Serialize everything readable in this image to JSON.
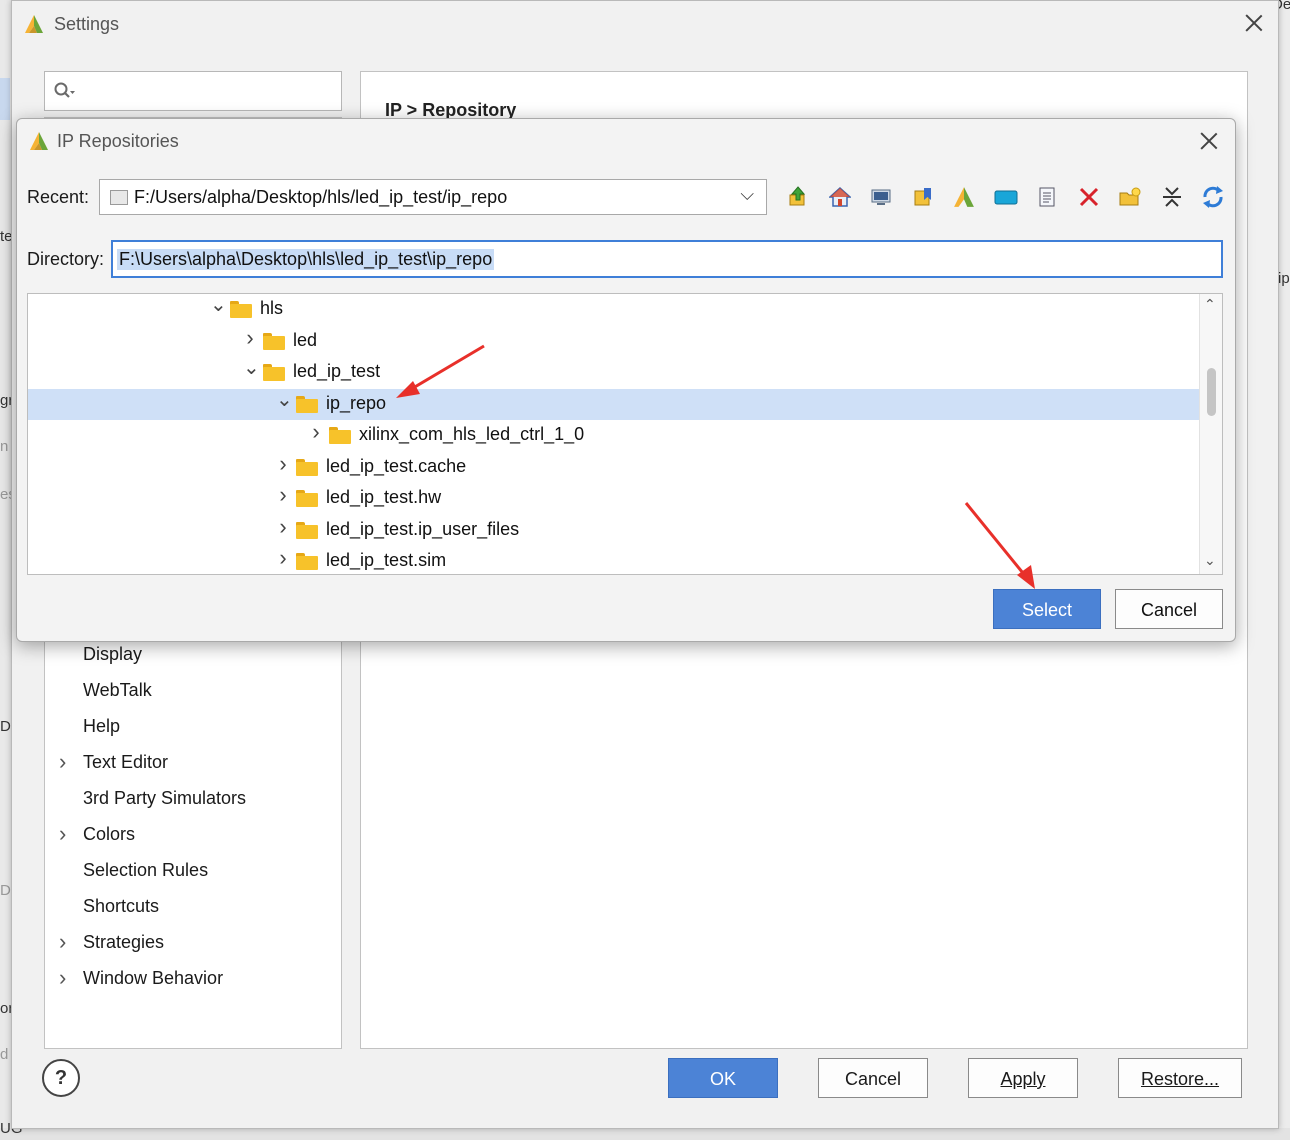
{
  "colors": {
    "accent": "#4c83d6",
    "selection": "#cfe0f7",
    "folder": "#f7c22a",
    "annotation_arrow": "#e8302a"
  },
  "background_fragments": {
    "te": "te",
    "gr": "gr",
    "n": "n",
    "es": "es",
    "De": "De",
    "D": "D",
    "or": "or",
    "d": "d",
    "UG": "UG",
    "ip": "ip",
    "top_right": "De"
  },
  "settings": {
    "title": "Settings",
    "search": {
      "placeholder": "",
      "icon": "search-icon"
    },
    "right_heading": "IP > Repository",
    "nav_items": [
      {
        "label": "Display",
        "expandable": false
      },
      {
        "label": "WebTalk",
        "expandable": false
      },
      {
        "label": "Help",
        "expandable": false
      },
      {
        "label": "Text Editor",
        "expandable": true
      },
      {
        "label": "3rd Party Simulators",
        "expandable": false
      },
      {
        "label": "Colors",
        "expandable": true
      },
      {
        "label": "Selection Rules",
        "expandable": false
      },
      {
        "label": "Shortcuts",
        "expandable": false
      },
      {
        "label": "Strategies",
        "expandable": true
      },
      {
        "label": "Window Behavior",
        "expandable": true
      }
    ],
    "help_label": "?",
    "buttons": {
      "ok": "OK",
      "cancel": "Cancel",
      "apply": "Apply",
      "restore": "Restore..."
    }
  },
  "ip_dialog": {
    "title": "IP Repositories",
    "recent_label": "Recent:",
    "recent_value": "F:/Users/alpha/Desktop/hls/led_ip_test/ip_repo",
    "directory_label": "Directory:",
    "directory_value": "F:\\Users\\alpha\\Desktop\\hls\\led_ip_test\\ip_repo",
    "toolbar_icons": [
      "up-folder-icon",
      "home-icon",
      "desktop-icon",
      "bookmark-icon",
      "vivado-project-icon",
      "panel-icon",
      "document-icon",
      "delete-icon",
      "new-folder-icon",
      "collapse-icon",
      "refresh-icon"
    ],
    "tree": [
      {
        "label": "hls",
        "expanded": true,
        "depth": 0,
        "selected": false
      },
      {
        "label": "led",
        "expanded": false,
        "depth": 1,
        "selected": false
      },
      {
        "label": "led_ip_test",
        "expanded": true,
        "depth": 1,
        "selected": false
      },
      {
        "label": "ip_repo",
        "expanded": true,
        "depth": 2,
        "selected": true
      },
      {
        "label": "xilinx_com_hls_led_ctrl_1_0",
        "expanded": false,
        "depth": 3,
        "selected": false
      },
      {
        "label": "led_ip_test.cache",
        "expanded": false,
        "depth": 2,
        "selected": false
      },
      {
        "label": "led_ip_test.hw",
        "expanded": false,
        "depth": 2,
        "selected": false
      },
      {
        "label": "led_ip_test.ip_user_files",
        "expanded": false,
        "depth": 2,
        "selected": false
      },
      {
        "label": "led_ip_test.sim",
        "expanded": false,
        "depth": 2,
        "selected": false
      }
    ],
    "buttons": {
      "select": "Select",
      "cancel": "Cancel"
    }
  }
}
